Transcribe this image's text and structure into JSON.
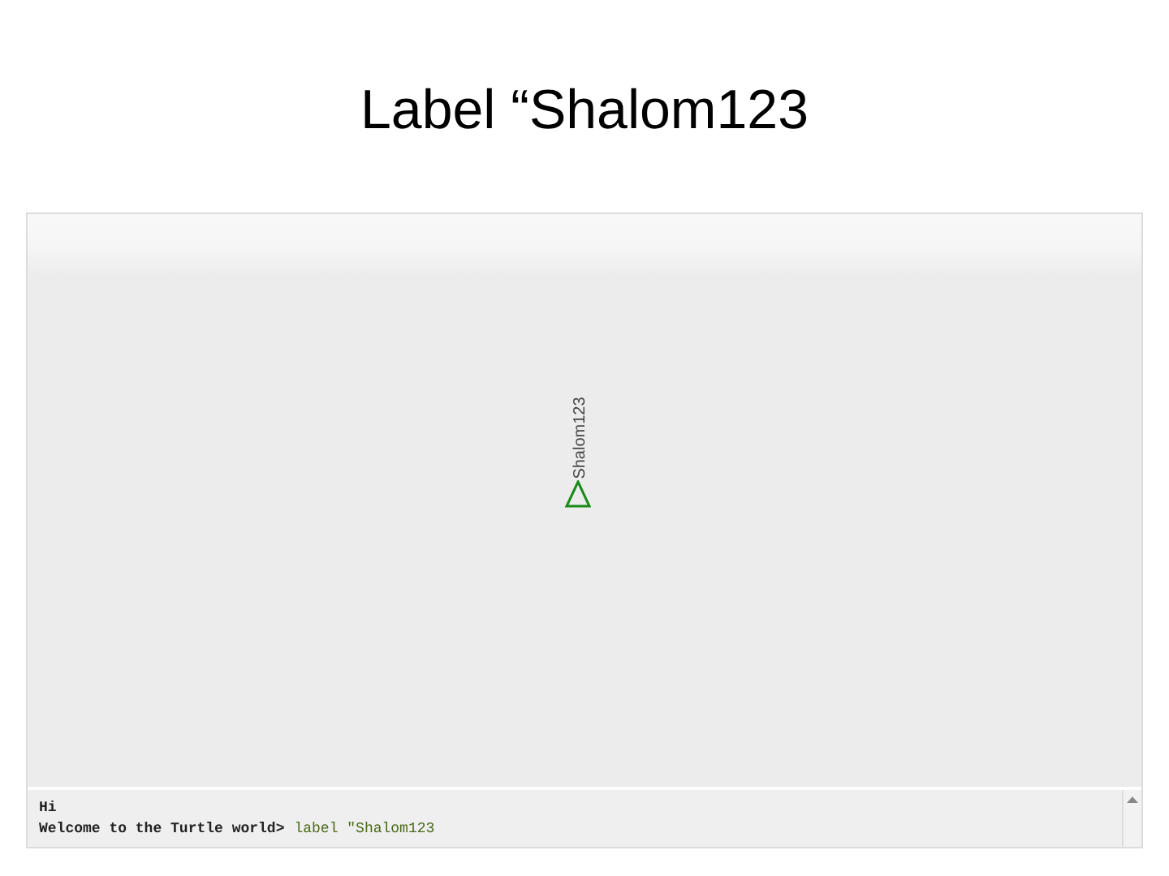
{
  "slide": {
    "title": "Label “Shalom123"
  },
  "canvas": {
    "label_text": "Shalom123"
  },
  "console": {
    "output": "Hi",
    "prompt": "Welcome to the Turtle world>",
    "command": "label \"Shalom123"
  }
}
